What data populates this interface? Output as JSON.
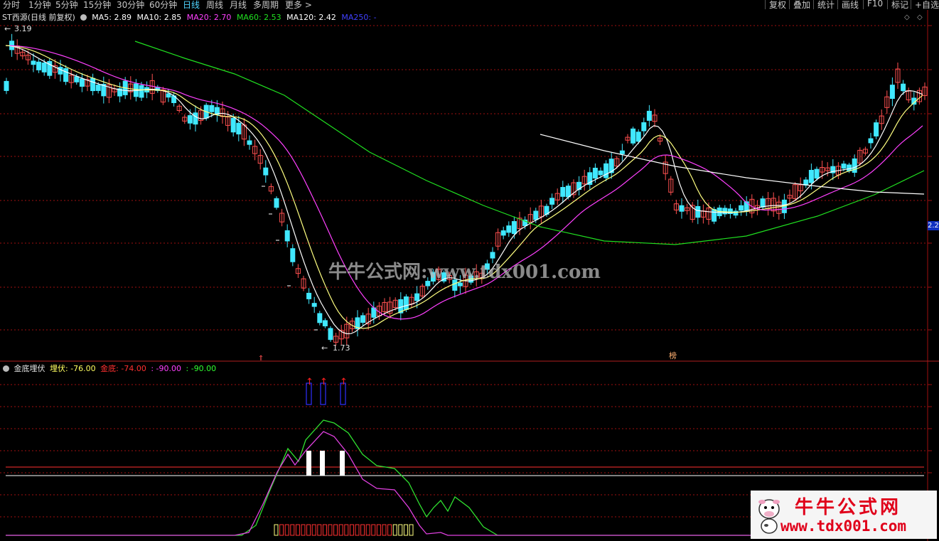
{
  "toolbar": {
    "periods": [
      "分时",
      "1分钟",
      "5分钟",
      "15分钟",
      "30分钟",
      "60分钟",
      "日线",
      "周线",
      "月线",
      "多周期",
      "更多 >"
    ],
    "active_period": "日线",
    "right_tools": [
      "复权",
      "叠加",
      "统计",
      "画线",
      "F10",
      "标记",
      "+自选"
    ]
  },
  "stock": {
    "title": "ST西源(日线 前复权)",
    "ma": [
      {
        "label": "MA5: 2.89",
        "color": "#ffffff"
      },
      {
        "label": "MA10: 2.85",
        "color": "#ffffff"
      },
      {
        "label": "MA20: 2.70",
        "color": "#ff40ff"
      },
      {
        "label": "MA60: 2.53",
        "color": "#20e020"
      },
      {
        "label": "MA120: 2.42",
        "color": "#ffffff"
      },
      {
        "label": "MA250: -",
        "color": "#4040ff"
      }
    ],
    "high_label": "3.19",
    "low_label": "1.73",
    "price_tag": "2.2",
    "bang_label": "榜"
  },
  "indicator": {
    "name": "金底埋伏",
    "values": [
      {
        "label": "埋伏: -76.00",
        "color": "#ffff60"
      },
      {
        "label": "金底: -74.00",
        "color": "#ff3030"
      },
      {
        "label": ": -90.00",
        "color": "#ff40ff"
      },
      {
        "label": ": -90.00",
        "color": "#30ff30"
      }
    ]
  },
  "watermark": {
    "center": "牛牛公式网:www.tdx001.com",
    "logo_name": "牛牛公式网",
    "logo_url": "www.tdx001.com"
  },
  "colors": {
    "up": "#ff5050",
    "down": "#40e8ff",
    "ma5": "#ffffff",
    "ma10": "#ffff80",
    "ma20": "#ff40ff",
    "ma60": "#20e020",
    "ma120": "#ffffff",
    "grid": "#a01010"
  }
}
